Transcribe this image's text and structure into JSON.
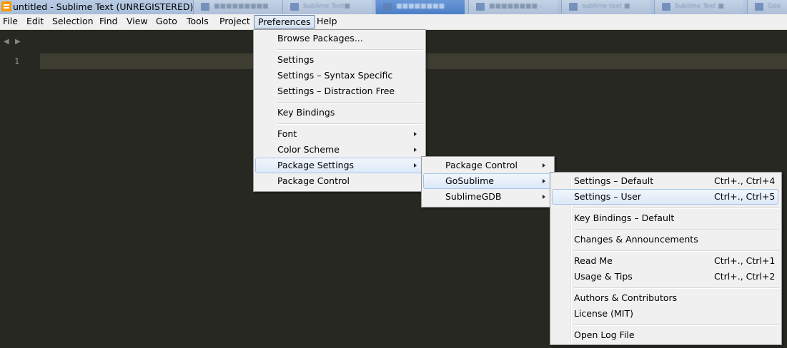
{
  "window": {
    "title": "untitled - Sublime Text (UNREGISTERED)"
  },
  "taskbar_tabs": [
    {
      "label": "■■■■■■■■■",
      "active": false
    },
    {
      "label": "Sublime Text■",
      "active": false
    },
    {
      "label": "■■■■■■■■",
      "active": true
    },
    {
      "label": "■■■■■■■■ -",
      "active": false
    },
    {
      "label": "sublime text ■",
      "active": false
    },
    {
      "label": "Sublime Text ■",
      "active": false
    },
    {
      "label": "Goo",
      "active": false
    }
  ],
  "menubar": {
    "items": [
      "File",
      "Edit",
      "Selection",
      "Find",
      "View",
      "Goto",
      "Tools",
      "Project",
      "Preferences",
      "Help"
    ],
    "open_item": "Preferences"
  },
  "editor": {
    "line_numbers": [
      "1"
    ]
  },
  "preferences_menu": {
    "browse_packages": "Browse Packages...",
    "settings": "Settings",
    "settings_syntax": "Settings – Syntax Specific",
    "settings_distraction": "Settings – Distraction Free",
    "key_bindings": "Key Bindings",
    "font": "Font",
    "color_scheme": "Color Scheme",
    "package_settings": "Package Settings",
    "package_control": "Package Control"
  },
  "package_settings_menu": {
    "package_control": "Package Control",
    "gosublime": "GoSublime",
    "sublimegdb": "SublimeGDB"
  },
  "gosublime_menu": {
    "settings_default": "Settings – Default",
    "settings_default_shortcut": "Ctrl+., Ctrl+4",
    "settings_user": "Settings – User",
    "settings_user_shortcut": "Ctrl+., Ctrl+5",
    "key_bindings_default": "Key Bindings – Default",
    "changes": "Changes & Announcements",
    "read_me": "Read Me",
    "read_me_shortcut": "Ctrl+., Ctrl+1",
    "usage_tips": "Usage & Tips",
    "usage_tips_shortcut": "Ctrl+., Ctrl+2",
    "authors": "Authors & Contributors",
    "license": "License (MIT)",
    "open_log": "Open Log File"
  },
  "colors": {
    "editor_bg": "#272822",
    "current_line": "#3e3d32",
    "menu_bg": "#f0f0f0",
    "highlight_border": "#a7c4e8"
  }
}
